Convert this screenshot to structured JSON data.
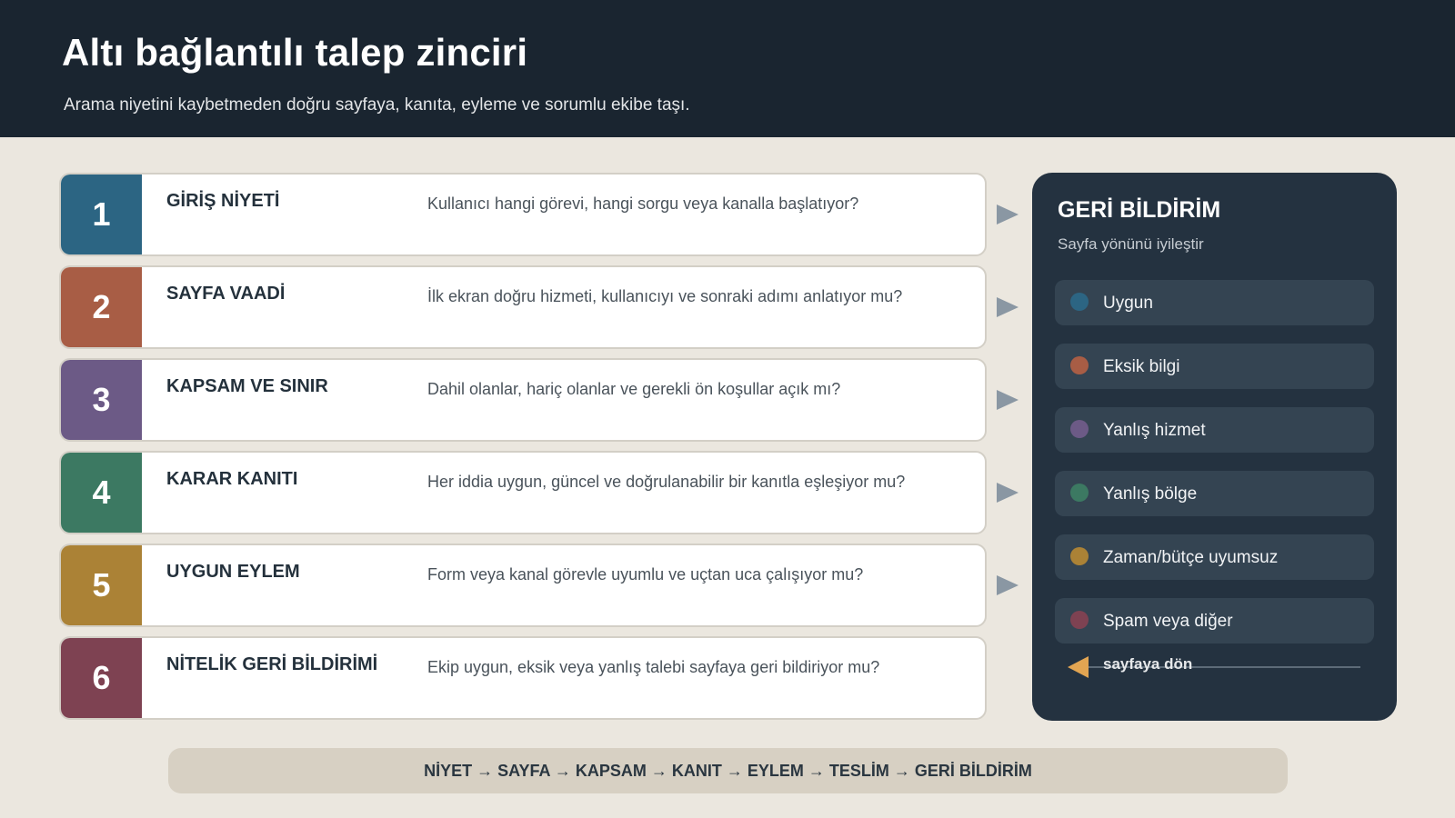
{
  "header": {
    "title": "Altı bağlantılı talep zinciri",
    "subtitle": "Arama niyetini kaybetmeden doğru sayfaya, kanıta, eyleme ve sorumlu ekibe taşı."
  },
  "steps": [
    {
      "num": "1",
      "label": "GİRİŞ NİYETİ",
      "desc": "Kullanıcı hangi görevi, hangi sorgu veya kanalla başlatıyor?",
      "color": "#2c6583"
    },
    {
      "num": "2",
      "label": "SAYFA VAADİ",
      "desc": "İlk ekran doğru hizmeti, kullanıcıyı ve sonraki adımı anlatıyor mu?",
      "color": "#a85d45"
    },
    {
      "num": "3",
      "label": "KAPSAM VE SINIR",
      "desc": "Dahil olanlar, hariç olanlar ve gerekli ön koşullar açık mı?",
      "color": "#6c5a86"
    },
    {
      "num": "4",
      "label": "KARAR KANITI",
      "desc": "Her iddia uygun, güncel ve doğrulanabilir bir kanıtla eşleşiyor mu?",
      "color": "#3c7962"
    },
    {
      "num": "5",
      "label": "UYGUN EYLEM",
      "desc": "Form veya kanal görevle uyumlu ve uçtan uca çalışıyor mu?",
      "color": "#ab8236"
    },
    {
      "num": "6",
      "label": "NİTELİK GERİ BİLDİRİMİ",
      "desc": "Ekip uygun, eksik veya yanlış talebi sayfaya geri bildiriyor mu?",
      "color": "#7e4252"
    }
  ],
  "feedback": {
    "title": "GERİ BİLDİRİM",
    "subtitle": "Sayfa yönünü iyileştir",
    "items": [
      {
        "label": "Uygun",
        "color": "#2c6583"
      },
      {
        "label": "Eksik bilgi",
        "color": "#a85d45"
      },
      {
        "label": "Yanlış hizmet",
        "color": "#6c5a86"
      },
      {
        "label": "Yanlış bölge",
        "color": "#3c7962"
      },
      {
        "label": "Zaman/bütçe uyumsuz",
        "color": "#ab8236"
      },
      {
        "label": "Spam veya diğer",
        "color": "#7e4252"
      }
    ],
    "return_label": "sayfaya dön",
    "return_color": "#e2a552"
  },
  "footer": {
    "flow": "NİYET → SAYFA → KAPSAM → KANIT → EYLEM → TESLİM → GERİ BİLDİRİM"
  }
}
